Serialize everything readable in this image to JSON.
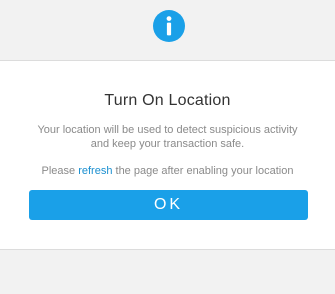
{
  "header": {
    "icon": "info-icon",
    "icon_color": "#1aa0e8"
  },
  "dialog": {
    "title": "Turn On Location",
    "description": "Your location will be used to detect suspicious activity and keep your transaction safe.",
    "hint_prefix": "Please ",
    "hint_link": "refresh",
    "hint_suffix": " the page after enabling your location",
    "ok_label": "OK",
    "accent_color": "#1aa0e8"
  }
}
